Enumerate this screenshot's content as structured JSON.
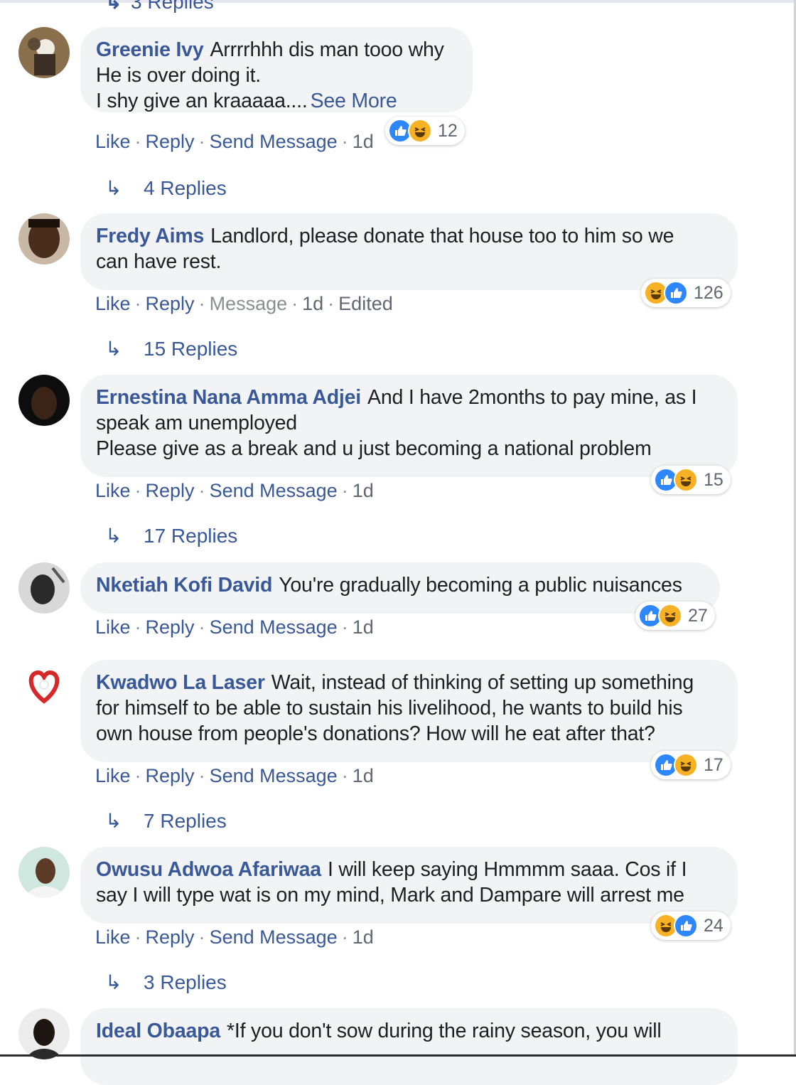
{
  "top_replies_partial": "3 Replies",
  "actions": {
    "like": "Like",
    "reply": "Reply",
    "send_message": "Send Message",
    "message": "Message",
    "dot": "·"
  },
  "comments": [
    {
      "author": "Greenie Ivy",
      "text": "Arrrrhhh dis man tooo why\nHe is over doing it.\nI shy give an kraaaaa....",
      "see_more": "See More",
      "time": "1d",
      "reaction_count": "12",
      "replies": "4 Replies"
    },
    {
      "author": "Fredy Aims",
      "text": "Landlord, please donate that house too to him so we\ncan have rest.",
      "time": "1d",
      "edited": "Edited",
      "reaction_count": "126",
      "replies": "15 Replies"
    },
    {
      "author": "Ernestina Nana Amma Adjei",
      "text": "And I have 2months to pay mine, as I\nspeak am unemployed\nPlease give as a break and u just becoming a national problem",
      "time": "1d",
      "reaction_count": "15",
      "replies": "17 Replies"
    },
    {
      "author": "Nketiah Kofi David",
      "text": "You're gradually becoming a public nuisances",
      "time": "1d",
      "reaction_count": "27"
    },
    {
      "author": "Kwadwo La Laser",
      "text": "Wait, instead of thinking of setting up something\nfor himself to be able to sustain his livelihood, he wants to build his\nown house from people's donations? How will he eat after that?",
      "time": "1d",
      "reaction_count": "17",
      "replies": "7 Replies"
    },
    {
      "author": "Owusu Adwoa Afariwaa",
      "text": "I will keep saying Hmmmm saaa. Cos if I\nsay I will type wat is on my mind, Mark and Dampare will arrest me",
      "time": "1d",
      "reaction_count": "24",
      "replies": "3 Replies"
    },
    {
      "author": "Ideal Obaapa",
      "text": "*If you don't sow during the rainy season, you will"
    }
  ]
}
